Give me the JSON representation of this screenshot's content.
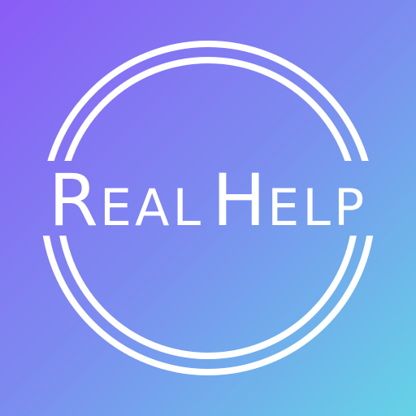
{
  "logo": {
    "word1_cap": "R",
    "word1_rest": "EAL",
    "word2_cap": "H",
    "word2_rest": "ELP",
    "text_color": "#ffffff",
    "ring_color": "#ffffff"
  },
  "background": {
    "gradient_start": "#8b5cf6",
    "gradient_mid": "#7c8cf0",
    "gradient_end": "#64d3e6"
  }
}
